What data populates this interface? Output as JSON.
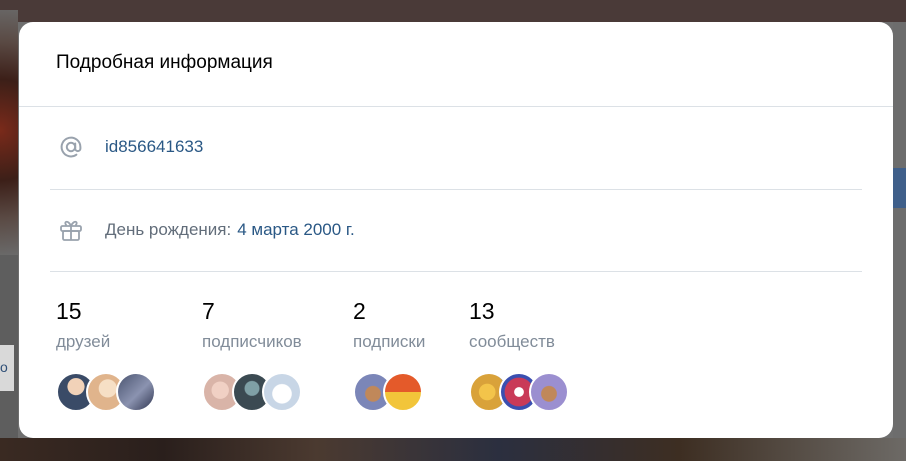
{
  "modal": {
    "title": "Подробная информация"
  },
  "info": {
    "username_icon": "at-icon",
    "username": "id856641633",
    "birthday_icon": "gift-icon",
    "birthday_label": "День рождения:",
    "birthday_value": "4 марта 2000 г."
  },
  "counters": [
    {
      "count": "15",
      "label": "друзей",
      "avatars": [
        "#3a4b67",
        "#e0b48c",
        "#4a5470"
      ]
    },
    {
      "count": "7",
      "label": "подписчиков",
      "avatars": [
        "#d9b4a8",
        "#3b4a52",
        "#c8d6e6"
      ]
    },
    {
      "count": "2",
      "label": "подписки",
      "avatars": [
        "#7b86b8",
        "#e45a2a"
      ]
    },
    {
      "count": "13",
      "label": "сообществ",
      "avatars": [
        "#d9a23a",
        "#c93a58",
        "#9b8fd0"
      ]
    }
  ],
  "colors": {
    "link": "#2a5885",
    "muted": "#818c99",
    "divider": "#dce1e6"
  }
}
